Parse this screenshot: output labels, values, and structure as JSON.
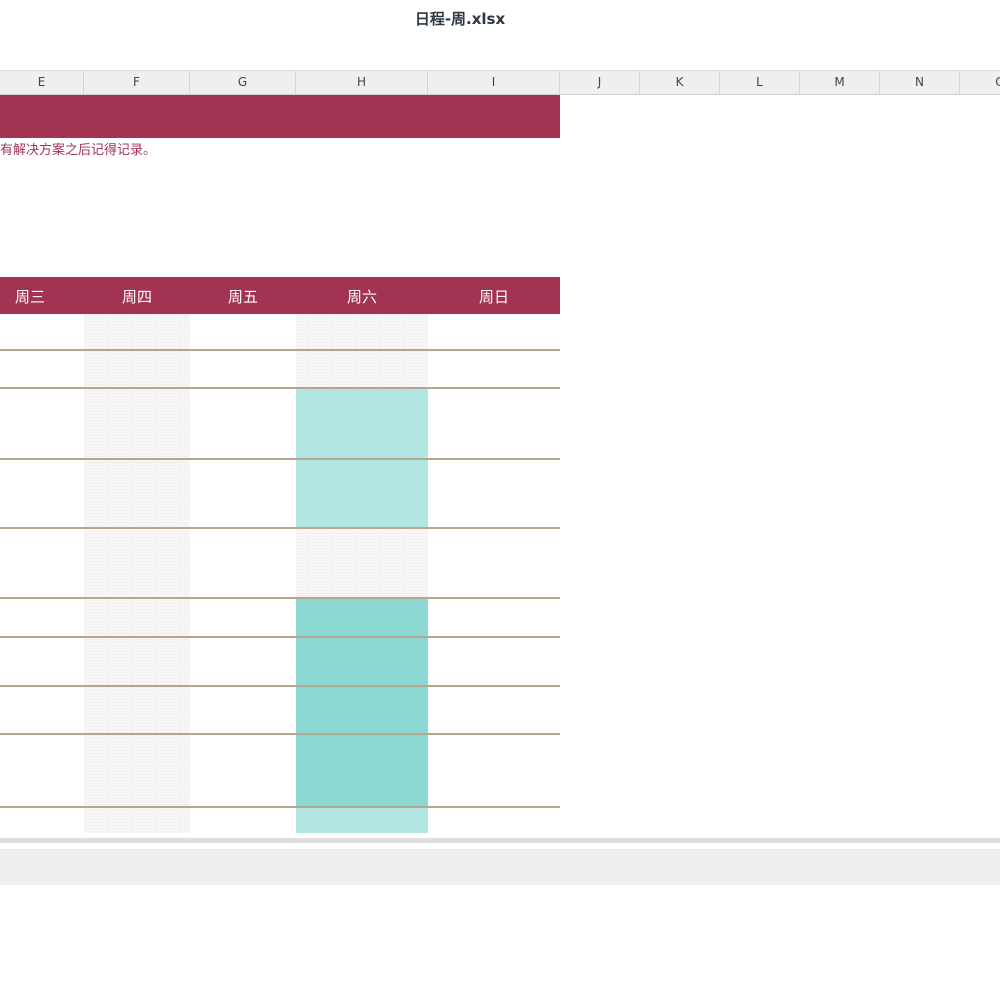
{
  "window": {
    "title": "日程-周.xlsx"
  },
  "columns": [
    "E",
    "F",
    "G",
    "H",
    "I",
    "J",
    "K",
    "L",
    "M",
    "N",
    "O"
  ],
  "sheet": {
    "note": "有解决方案之后记得记录。",
    "days": [
      "周三",
      "周四",
      "周五",
      "周六",
      "周日"
    ]
  },
  "colors": {
    "banner": "#a33353",
    "row_divider": "#b5a68d",
    "teal_light": "#b2e6e3",
    "teal_mid": "#8bd8d3"
  }
}
